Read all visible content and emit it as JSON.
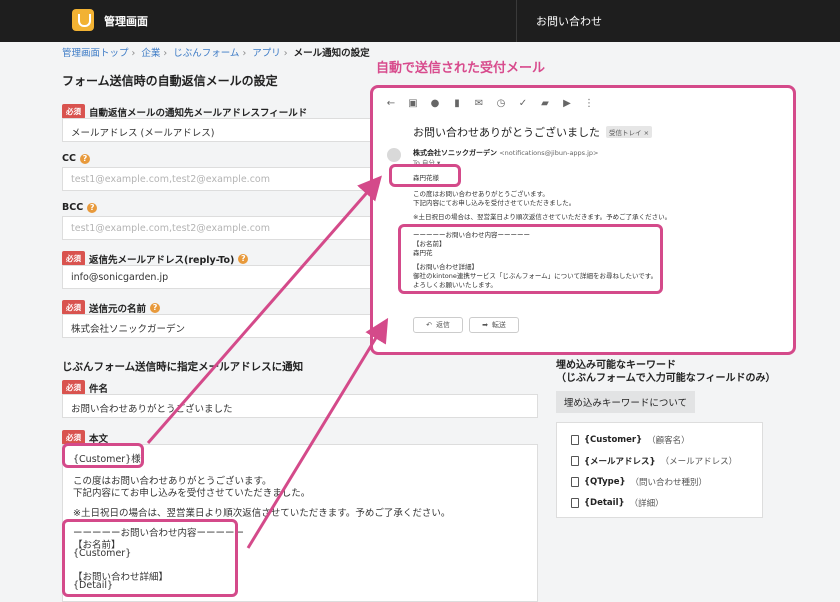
{
  "header": {
    "app_title": "管理画面",
    "contact_link": "お問い合わせ"
  },
  "breadcrumb": {
    "items": [
      "管理画面トップ",
      "企業",
      "じぶんフォーム",
      "アプリ"
    ],
    "current": "メール通知の設定"
  },
  "form": {
    "section_title": "フォーム送信時の自動返信メールの設定",
    "required_badge": "必須",
    "fields": [
      {
        "label": "自動返信メールの通知先メールアドレスフィールド",
        "value": "メールアドレス (メールアドレス)",
        "required": true
      },
      {
        "label": "CC",
        "placeholder": "test1@example.com,test2@example.com",
        "required": false
      },
      {
        "label": "BCC",
        "placeholder": "test1@example.com,test2@example.com",
        "required": false
      },
      {
        "label": "返信先メールアドレス(reply-To)",
        "value": "info@sonicgarden.jp",
        "required": true
      },
      {
        "label": "送信元の名前",
        "value": "株式会社ソニックガーデン",
        "required": true
      }
    ],
    "notify_section_title": "じぶんフォーム送信時に指定メールアドレスに通知",
    "subject_label": "件名",
    "subject_value": "お問い合わせありがとうございました",
    "body_label": "本文",
    "body_lines": [
      "{Customer}様",
      "この度はお問い合わせありがとうございます。",
      "下記内容にてお申し込みを受付させていただきました。",
      "※土日祝日の場合は、翌営業日より順次返信させていただきます。予めご了承ください。",
      "ーーーーーお問い合わせ内容ーーーーー",
      "【お名前】",
      "{Customer}",
      "【お問い合わせ詳細】",
      "{Detail}"
    ]
  },
  "annotation": {
    "title": "自動で送信された受付メール"
  },
  "email_preview": {
    "subject": "お問い合わせありがとうございました",
    "inbox_tag": "受信トレイ ×",
    "sender_name": "株式会社ソニックガーデン",
    "sender_email": "<notifications@jibun-apps.jp>",
    "to_line": "To 自分 ▾",
    "body_lines": [
      "森円花様",
      "この度はお問い合わせありがとうございます。",
      "下記内容にてお申し込みを受付させていただきました。",
      "※土日祝日の場合は、翌営業日より順次返信させていただきます。予めご了承ください。",
      "ーーーーーお問い合わせ内容ーーーーー",
      "【お名前】",
      "森円花",
      "【お問い合わせ詳細】",
      "御社のkintone連携サービス「じぶんフォーム」について詳細をお尋ねしたいです。",
      "よろしくお願いいたします。"
    ],
    "reply_label": "返信",
    "forward_label": "転送"
  },
  "keywords": {
    "title_line1": "埋め込み可能なキーワード",
    "title_line2": "（じぶんフォームで入力可能なフィールドのみ）",
    "about_button": "埋め込みキーワードについて",
    "items": [
      {
        "key": "{Customer}",
        "desc": "（顧客名）"
      },
      {
        "key": "{メールアドレス}",
        "desc": "（メールアドレス）"
      },
      {
        "key": "{QType}",
        "desc": "（問い合わせ種別）"
      },
      {
        "key": "{Detail}",
        "desc": "（詳細）"
      }
    ]
  },
  "colors": {
    "accent": "#d44a8a",
    "required": "#d9534f",
    "link": "#3d7bc6",
    "header": "#1e1e1e"
  }
}
